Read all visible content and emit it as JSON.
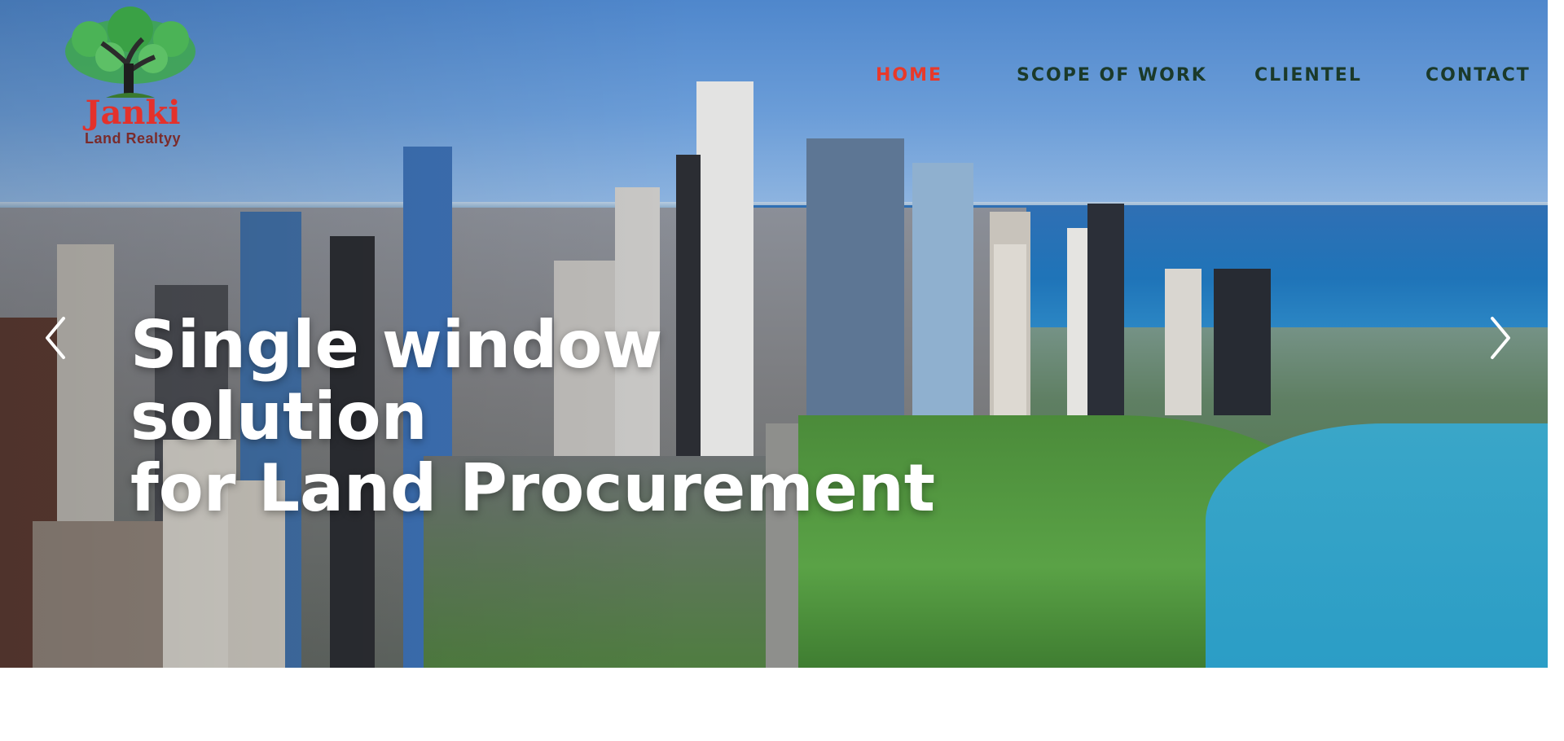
{
  "brand": {
    "name": "Janki",
    "tagline": "Land Realtyy",
    "logo_icon": "tree-logo-icon"
  },
  "nav": {
    "items": [
      {
        "label": "HOME",
        "active": true
      },
      {
        "label": "SCOPE OF WORK",
        "active": false
      },
      {
        "label": "CLIENTEL",
        "active": false
      },
      {
        "label": "CONTACT",
        "active": false
      }
    ]
  },
  "hero": {
    "title_line1": "Single window solution",
    "title_line2": "for Land Procurement",
    "prev_icon": "chevron-left-icon",
    "next_icon": "chevron-right-icon"
  },
  "colors": {
    "nav_text": "#1b3a2a",
    "nav_active": "#e8392a",
    "brand_red": "#e4312b",
    "hero_text": "#ffffff"
  }
}
